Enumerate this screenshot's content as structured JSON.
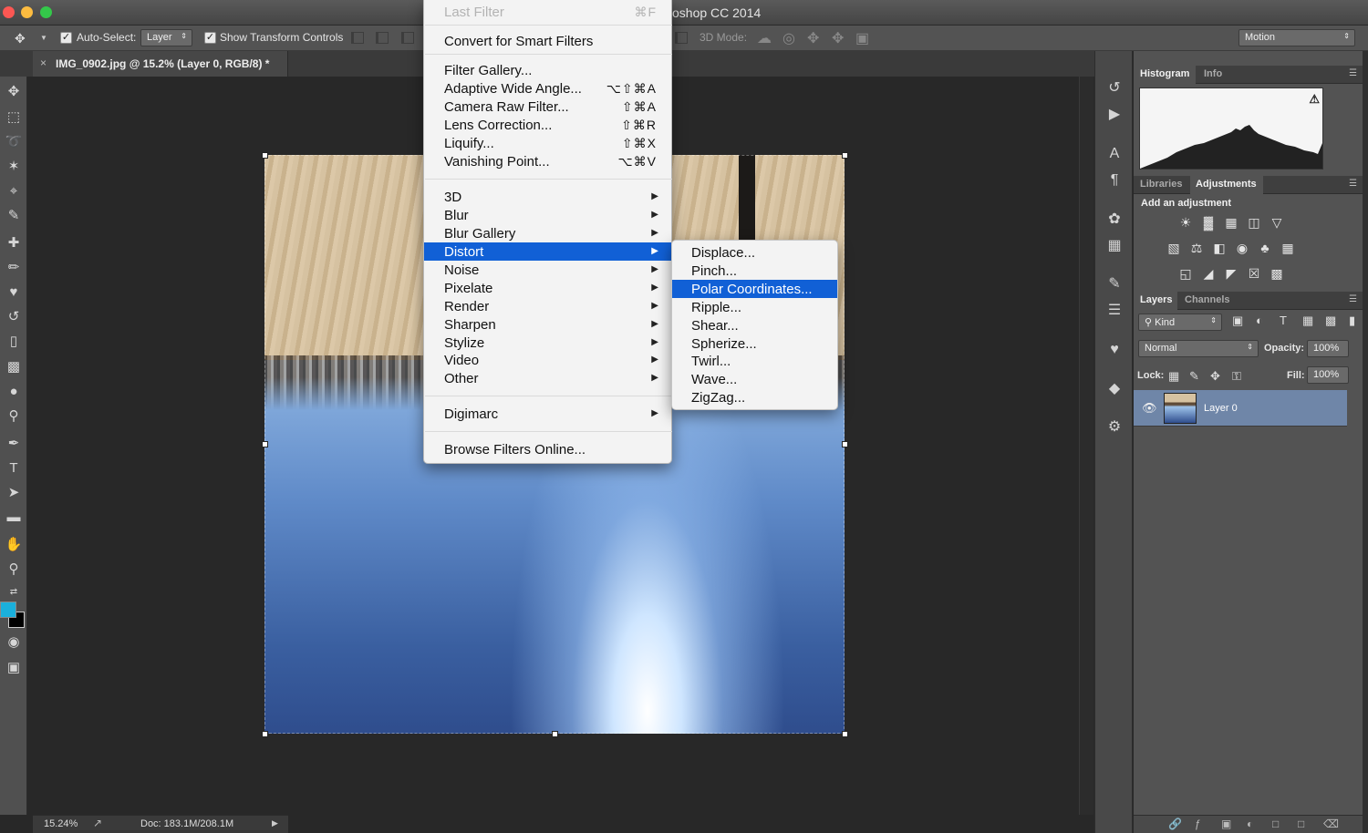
{
  "window": {
    "title": "oshop CC 2014"
  },
  "options_bar": {
    "auto_select_label": "Auto-Select:",
    "auto_select_value": "Layer",
    "show_transform_label": "Show Transform Controls",
    "mode3d_label": "3D Mode:",
    "workspace_value": "Motion"
  },
  "document": {
    "tab_label": "IMG_0902.jpg @ 15.2% (Layer 0, RGB/8) *",
    "tab_close": "×",
    "zoom": "15.24%",
    "doc_size": "Doc: 183.1M/208.1M"
  },
  "filter_menu": {
    "last_filter": {
      "label": "Last Filter",
      "shortcut": "⌘F"
    },
    "convert_smart": "Convert for Smart Filters",
    "group1": [
      {
        "label": "Filter Gallery...",
        "shortcut": ""
      },
      {
        "label": "Adaptive Wide Angle...",
        "shortcut": "⌥⇧⌘A"
      },
      {
        "label": "Camera Raw Filter...",
        "shortcut": "⇧⌘A"
      },
      {
        "label": "Lens Correction...",
        "shortcut": "⇧⌘R"
      },
      {
        "label": "Liquify...",
        "shortcut": "⇧⌘X"
      },
      {
        "label": "Vanishing Point...",
        "shortcut": "⌥⌘V"
      }
    ],
    "group2": [
      "3D",
      "Blur",
      "Blur Gallery",
      "Distort",
      "Noise",
      "Pixelate",
      "Render",
      "Sharpen",
      "Stylize",
      "Video",
      "Other"
    ],
    "digimarc": "Digimarc",
    "browse": "Browse Filters Online...",
    "submenu_arrow": "▶"
  },
  "distort_submenu": [
    "Displace...",
    "Pinch...",
    "Polar Coordinates...",
    "Ripple...",
    "Shear...",
    "Spherize...",
    "Twirl...",
    "Wave...",
    "ZigZag..."
  ],
  "panels": {
    "top_tabs": [
      "Histogram",
      "Info"
    ],
    "mid_tabs": [
      "Libraries",
      "Adjustments"
    ],
    "add_adjustment": "Add an adjustment",
    "layer_tabs": [
      "Layers",
      "Channels"
    ],
    "kind_filter": "Kind",
    "blend_mode": "Normal",
    "opacity_label": "Opacity:",
    "opacity_value": "100%",
    "lock_label": "Lock:",
    "fill_label": "Fill:",
    "fill_value": "100%",
    "layer_name": "Layer 0"
  },
  "colors": {
    "foreground": "#1ab0dc",
    "background": "#000000",
    "menu_highlight": "#1160d6"
  }
}
